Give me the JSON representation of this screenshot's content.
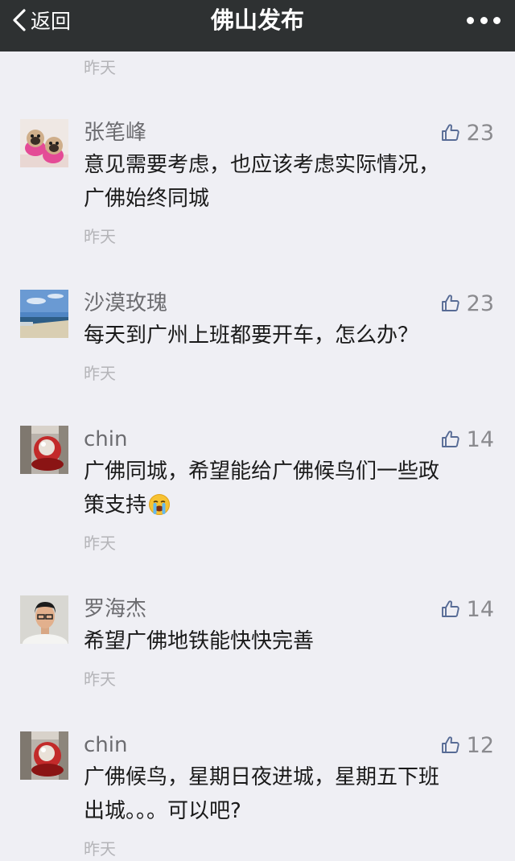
{
  "navbar": {
    "back_label": "返回",
    "title": "佛山发布",
    "back_icon": "chevron-left-icon",
    "more_icon": "more-dots-icon"
  },
  "top_time": "昨天",
  "like_icon": "thumbs-up-icon",
  "comments": [
    {
      "name": "张笔峰",
      "likes": "23",
      "text_lines": [
        "意见需要考虑，也应该考虑实际情况，",
        "广佛始终同城"
      ],
      "time": "昨天"
    },
    {
      "name": "沙漠玫瑰",
      "likes": "23",
      "text_lines": [
        "每天到广州上班都要开车，怎么办？"
      ],
      "time": "昨天"
    },
    {
      "name": "chin",
      "likes": "14",
      "text_lines": [
        "广佛同城，希望能给广佛候鸟们一些政",
        "策支持"
      ],
      "emoji": "crying-face-emoji",
      "time": "昨天"
    },
    {
      "name": "罗海杰",
      "likes": "14",
      "text_lines": [
        "希望广佛地铁能快快完善"
      ],
      "time": "昨天"
    },
    {
      "name": "chin",
      "likes": "12",
      "text_lines": [
        "广佛候鸟，星期日夜进城，星期五下班",
        "出城。。。可以吧?"
      ],
      "time": "昨天"
    }
  ]
}
